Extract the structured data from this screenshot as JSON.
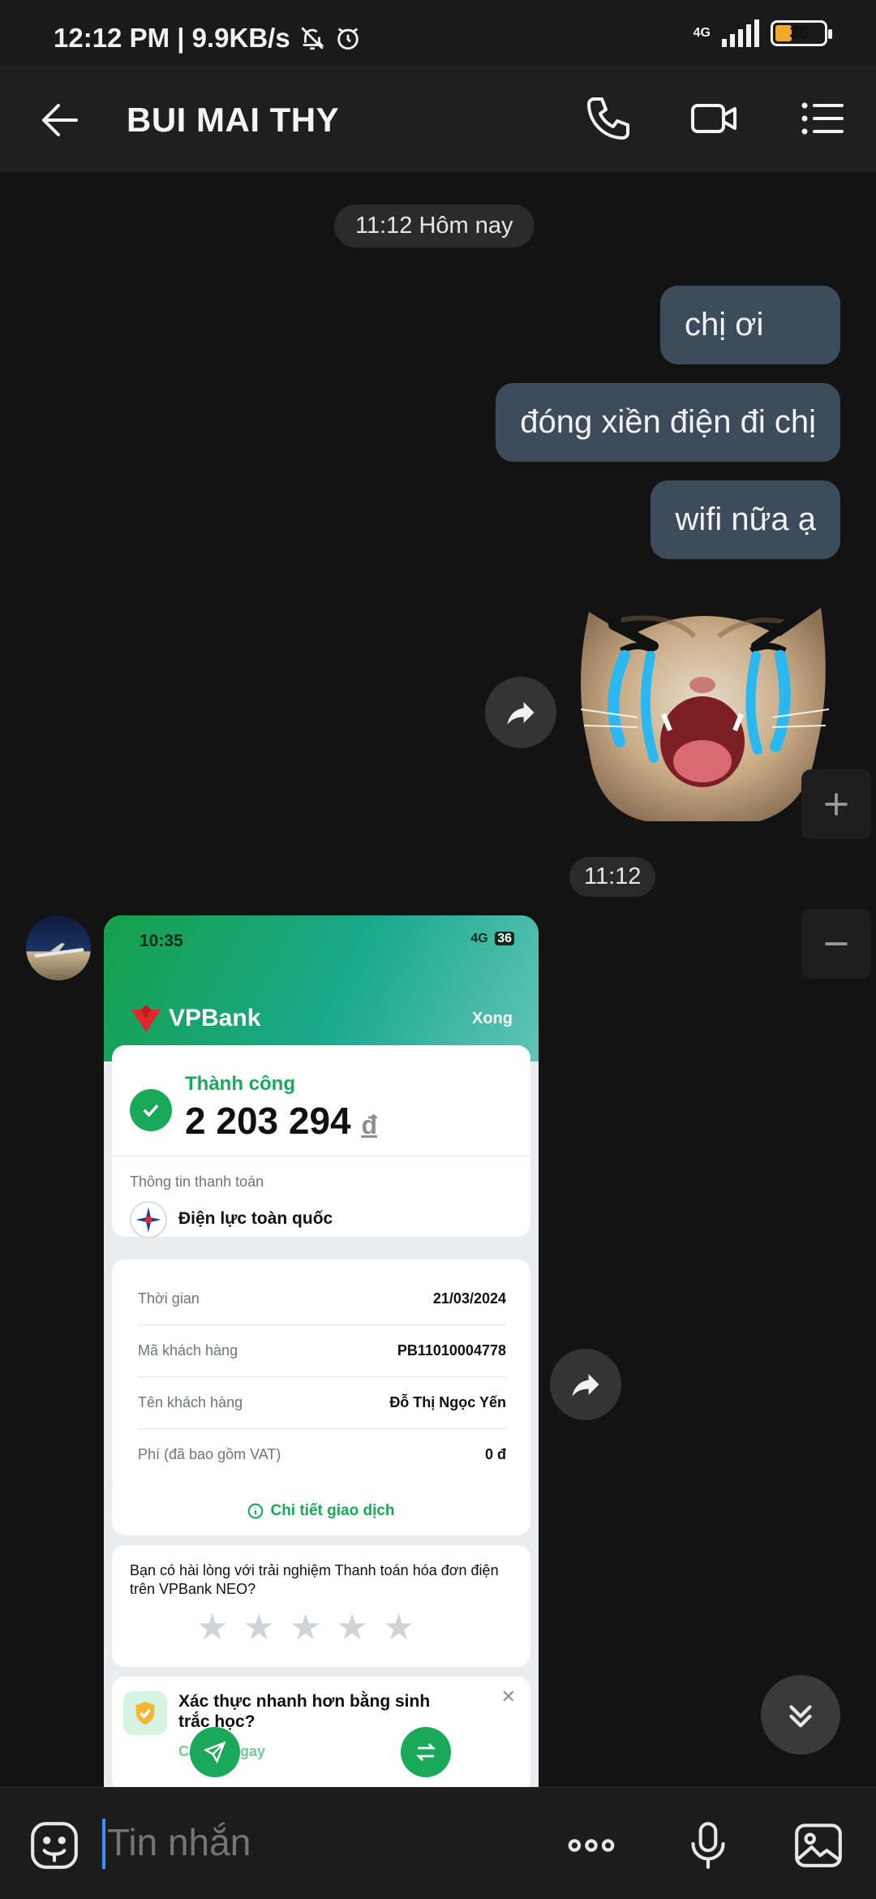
{
  "status_bar": {
    "time": "12:12 PM | 9.9KB/s",
    "network": "4G",
    "battery": "36"
  },
  "header": {
    "title": "BUI MAI THY"
  },
  "chat": {
    "date_label": "11:12 Hôm nay",
    "messages": [
      "chị ơi",
      "đóng xiền điện đi chị",
      "wifi nữa ạ"
    ],
    "sticker_time": "11:12"
  },
  "receipt": {
    "time": "10:35",
    "network": "4G",
    "battery": "36",
    "logo": "VPBank",
    "done": "Xong",
    "success": "Thành công",
    "amount": "2 203 294",
    "currency": "đ",
    "payment_info_label": "Thông tin thanh toán",
    "provider": "Điện lực toàn quốc",
    "rows": [
      {
        "k": "Thời gian",
        "v": "21/03/2024"
      },
      {
        "k": "Mã khách hàng",
        "v": "PB11010004778"
      },
      {
        "k": "Tên khách hàng",
        "v": "Đỗ Thị Ngọc Yến"
      },
      {
        "k": "Phí (đã bao gồm VAT)",
        "v": "0 đ"
      }
    ],
    "details_link": "Chi tiết giao dịch",
    "survey": "Bạn có hài lòng với trải nghiệm Thanh toán hóa đơn điện trên VPBank NEO?",
    "rating": 0,
    "bio_title": "Xác thực nhanh hơn bằng sinh trắc học?",
    "bio_link": "Cài đặt ngay"
  },
  "input": {
    "placeholder": "Tin nhắn"
  },
  "colors": {
    "bubble": "#3d4c5b",
    "accent_green": "#1aa85a",
    "caret": "#3d8bff"
  }
}
